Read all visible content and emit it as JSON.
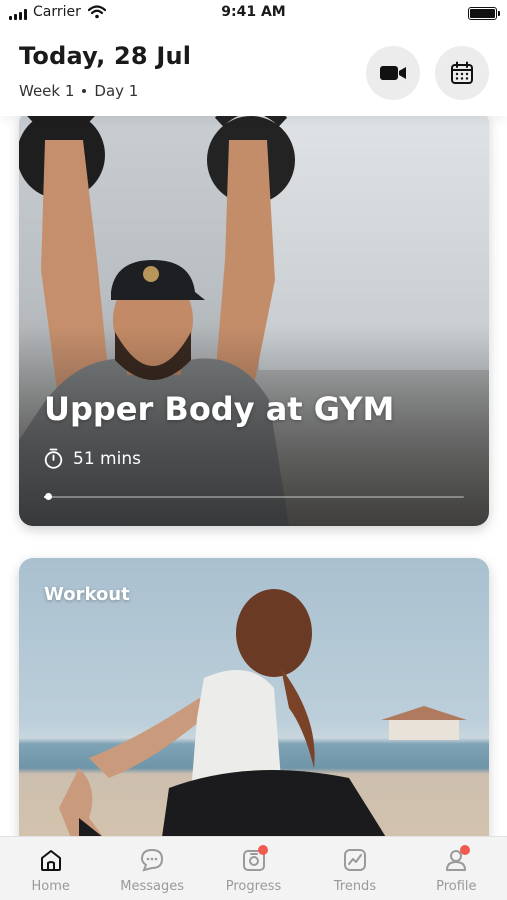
{
  "status_bar": {
    "carrier": "Carrier",
    "time": "9:41 AM",
    "icons": [
      "signal-icon",
      "wifi-icon",
      "battery-icon"
    ]
  },
  "header": {
    "title": "Today, 28 Jul",
    "week": "Week 1",
    "day": "Day 1",
    "actions": [
      "video-camera-icon",
      "calendar-icon"
    ]
  },
  "cards": [
    {
      "title": "Upper Body at GYM",
      "duration": "51 mins",
      "progress": 0.01,
      "icon": "stopwatch-icon"
    },
    {
      "label": "Workout"
    }
  ],
  "tabs": [
    {
      "label": "Home",
      "icon": "home-icon",
      "active": true,
      "badge": false
    },
    {
      "label": "Messages",
      "icon": "messages-icon",
      "active": false,
      "badge": false
    },
    {
      "label": "Progress",
      "icon": "progress-icon",
      "active": false,
      "badge": true
    },
    {
      "label": "Trends",
      "icon": "trends-icon",
      "active": false,
      "badge": false
    },
    {
      "label": "Profile",
      "icon": "profile-icon",
      "active": false,
      "badge": true
    }
  ],
  "colors": {
    "badge": "#f05a4f",
    "active_tab": "#111111",
    "inactive_tab": "#9a9a9a",
    "header_button_bg": "#ececec"
  }
}
